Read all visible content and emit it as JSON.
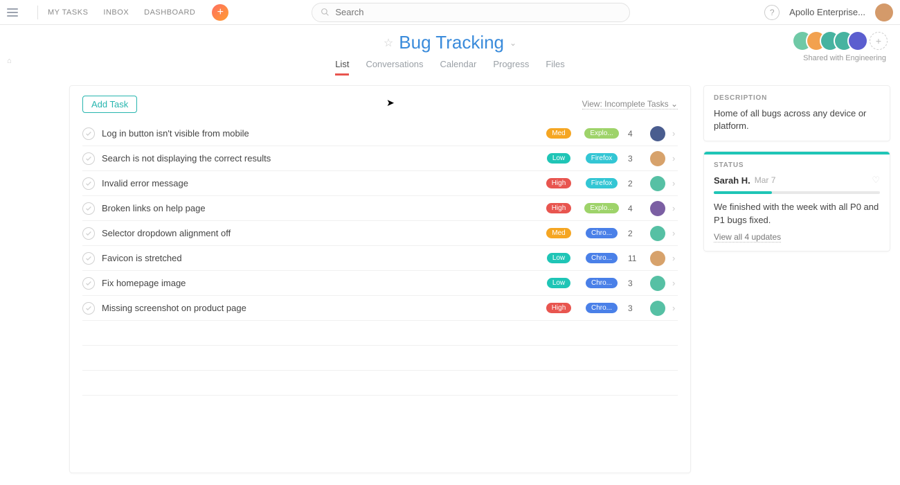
{
  "topnav": {
    "my_tasks": "MY TASKS",
    "inbox": "INBOX",
    "dashboard": "DASHBOARD"
  },
  "search": {
    "placeholder": "Search"
  },
  "workspace": "Apollo Enterprise...",
  "project": {
    "title": "Bug Tracking",
    "tabs": {
      "list": "List",
      "conversations": "Conversations",
      "calendar": "Calendar",
      "progress": "Progress",
      "files": "Files"
    },
    "shared_with": "Shared with Engineering"
  },
  "main": {
    "add_task": "Add Task",
    "view_label": "View: Incomplete Tasks",
    "tasks": [
      {
        "title": "Log in button isn't visible from mobile",
        "priority": "Med",
        "priority_class": "med",
        "browser": "Explo...",
        "browser_class": "explorer",
        "count": "4"
      },
      {
        "title": "Search is not displaying the correct results",
        "priority": "Low",
        "priority_class": "low",
        "browser": "Firefox",
        "browser_class": "firefox",
        "count": "3"
      },
      {
        "title": "Invalid error message",
        "priority": "High",
        "priority_class": "high",
        "browser": "Firefox",
        "browser_class": "firefox",
        "count": "2"
      },
      {
        "title": "Broken links on help page",
        "priority": "High",
        "priority_class": "high",
        "browser": "Explo...",
        "browser_class": "explorer",
        "count": "4"
      },
      {
        "title": "Selector dropdown alignment off",
        "priority": "Med",
        "priority_class": "med",
        "browser": "Chro...",
        "browser_class": "chrome",
        "count": "2"
      },
      {
        "title": "Favicon is stretched",
        "priority": "Low",
        "priority_class": "low",
        "browser": "Chro...",
        "browser_class": "chrome",
        "count": "11"
      },
      {
        "title": "Fix homepage image",
        "priority": "Low",
        "priority_class": "low",
        "browser": "Chro...",
        "browser_class": "chrome",
        "count": "3"
      },
      {
        "title": "Missing screenshot on product page",
        "priority": "High",
        "priority_class": "high",
        "browser": "Chro...",
        "browser_class": "chrome",
        "count": "3"
      }
    ]
  },
  "side": {
    "description": {
      "heading": "DESCRIPTION",
      "body": "Home of all bugs across any device or platform."
    },
    "status": {
      "heading": "STATUS",
      "author": "Sarah H.",
      "date": "Mar 7",
      "body": "We finished with the week with all P0 and P1 bugs fixed.",
      "view_all": "View all 4 updates"
    }
  }
}
